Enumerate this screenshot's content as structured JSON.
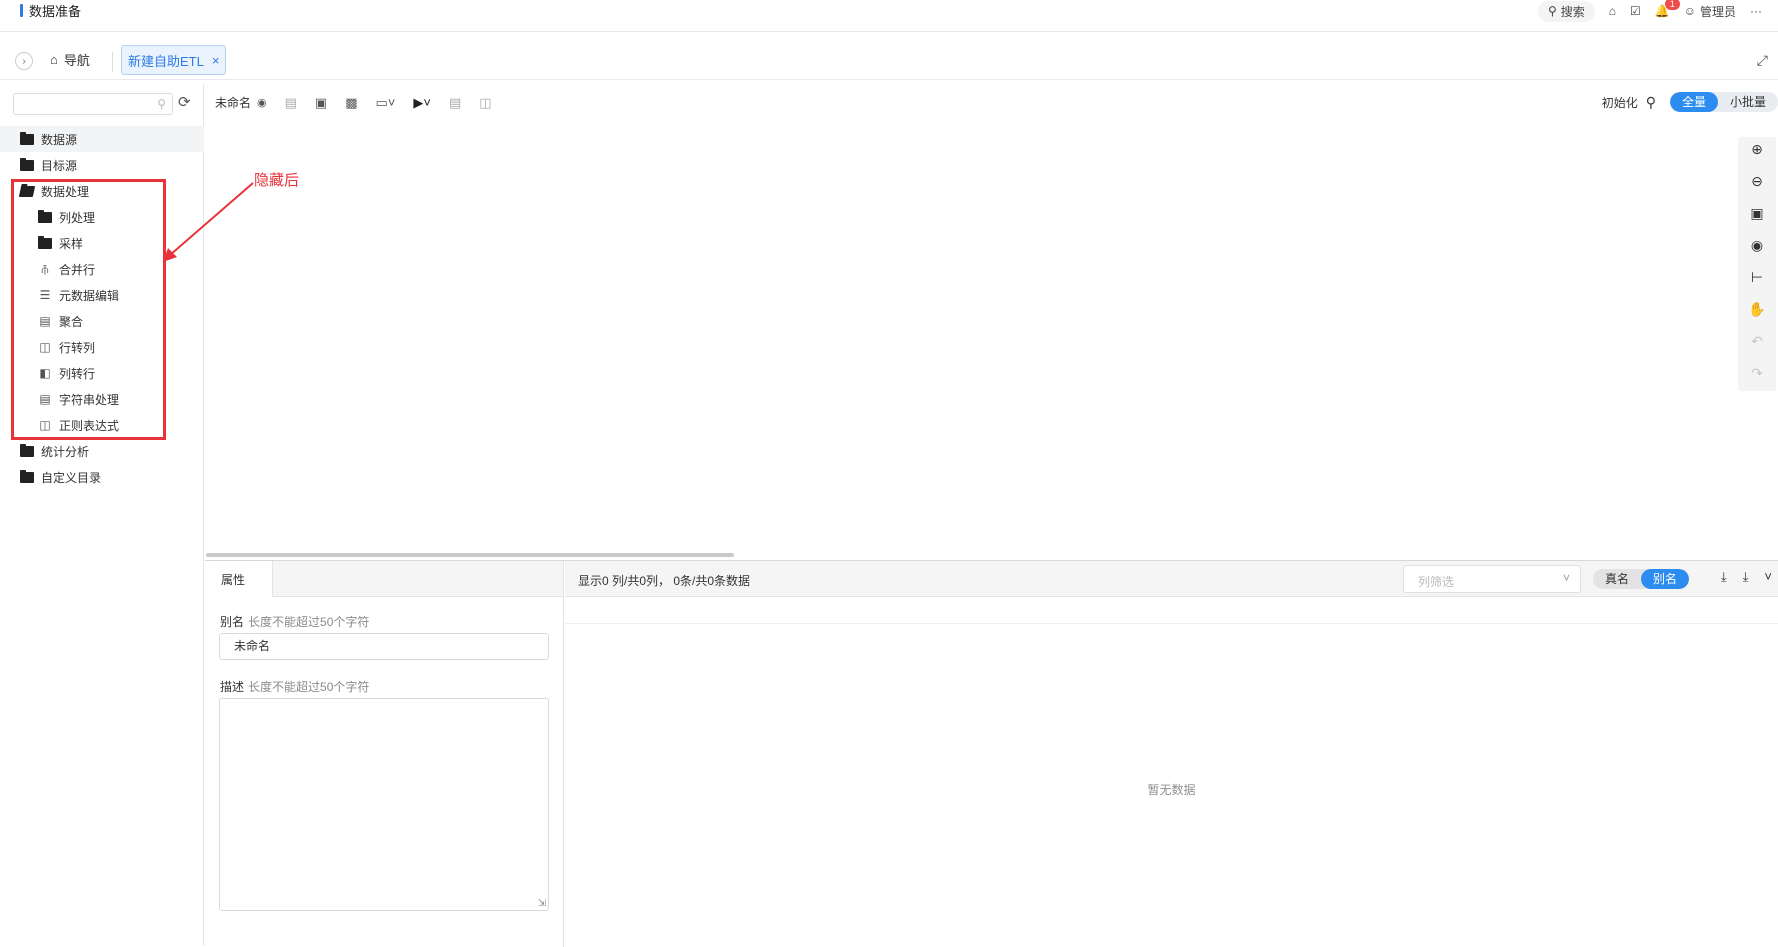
{
  "app": {
    "title": "数据准备",
    "accent": "#2d7be5"
  },
  "topbar": {
    "search_label": "搜索",
    "notification_count": "1",
    "user_label": "管理员",
    "more": "···"
  },
  "tabs": {
    "nav_label": "导航",
    "active_tab": "新建自助ETL",
    "close": "×"
  },
  "sidebar": {
    "search_placeholder": "",
    "items": [
      {
        "label": "数据源",
        "icon": "folder-icon"
      },
      {
        "label": "目标源",
        "icon": "folder-icon"
      },
      {
        "label": "数据处理",
        "icon": "folder-open-icon"
      },
      {
        "label": "列处理",
        "icon": "folder-icon"
      },
      {
        "label": "采样",
        "icon": "folder-icon"
      },
      {
        "label": "合并行",
        "icon": "merge-rows-icon"
      },
      {
        "label": "元数据编辑",
        "icon": "metadata-icon"
      },
      {
        "label": "聚合",
        "icon": "aggregate-icon"
      },
      {
        "label": "行转列",
        "icon": "row-to-col-icon"
      },
      {
        "label": "列转行",
        "icon": "col-to-row-icon"
      },
      {
        "label": "字符串处理",
        "icon": "string-icon"
      },
      {
        "label": "正则表达式",
        "icon": "regex-icon"
      },
      {
        "label": "统计分析",
        "icon": "folder-icon"
      },
      {
        "label": "自定义目录",
        "icon": "folder-icon"
      }
    ]
  },
  "annotation": {
    "text": "隐藏后",
    "color": "#e8333a"
  },
  "canvas": {
    "name": "未命名",
    "init_label": "初始化",
    "mode_full": "全量",
    "mode_batch": "小批量"
  },
  "properties": {
    "tab": "属性",
    "alias_label": "别名",
    "alias_hint": "长度不能超过50个字符",
    "alias_value": "未命名",
    "desc_label": "描述",
    "desc_hint": "长度不能超过50个字符"
  },
  "datagrid": {
    "info": "显示0 列/共0列， 0条/共0条数据",
    "column_filter_placeholder": "列筛选",
    "real_name": "真名",
    "alias": "别名",
    "empty": "暂无数据"
  }
}
